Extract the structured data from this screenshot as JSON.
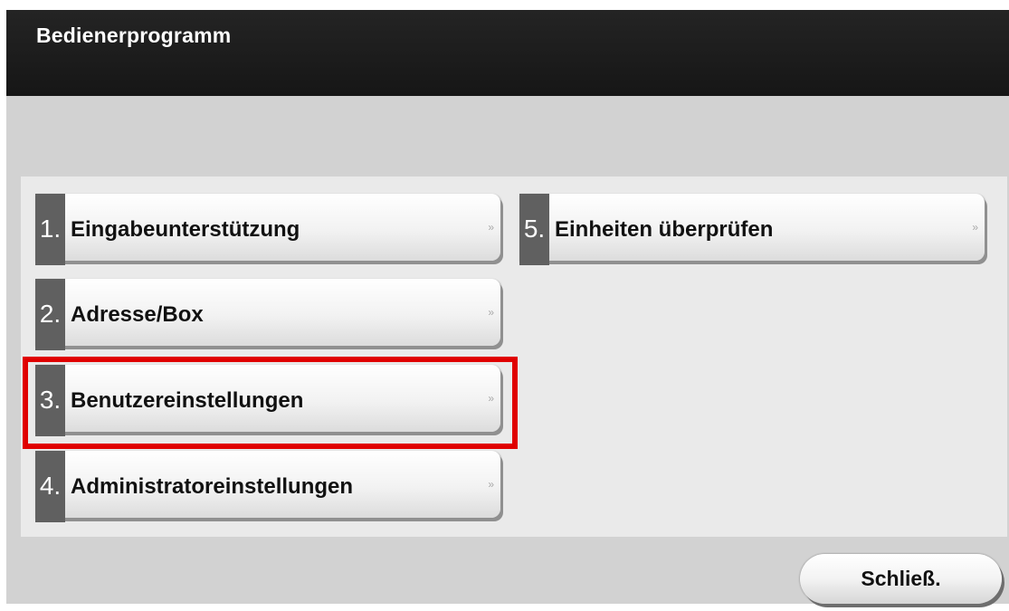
{
  "header": {
    "title": "Bedienerprogramm"
  },
  "menu": {
    "items": [
      {
        "number": "1.",
        "label": "Eingabeunterstützung",
        "arrow": "»"
      },
      {
        "number": "2.",
        "label": "Adresse/Box",
        "arrow": "»"
      },
      {
        "number": "3.",
        "label": "Benutzereinstellungen",
        "arrow": "»"
      },
      {
        "number": "4.",
        "label": "Administratoreinstellungen",
        "arrow": "»"
      },
      {
        "number": "5.",
        "label": "Einheiten überprüfen",
        "arrow": "»"
      }
    ]
  },
  "footer": {
    "close_label": "Schließ."
  },
  "colors": {
    "header_bg": "#1c1c1c",
    "screen_bg": "#d2d2d2",
    "number_tab": "#606060",
    "highlight": "#e00000"
  }
}
